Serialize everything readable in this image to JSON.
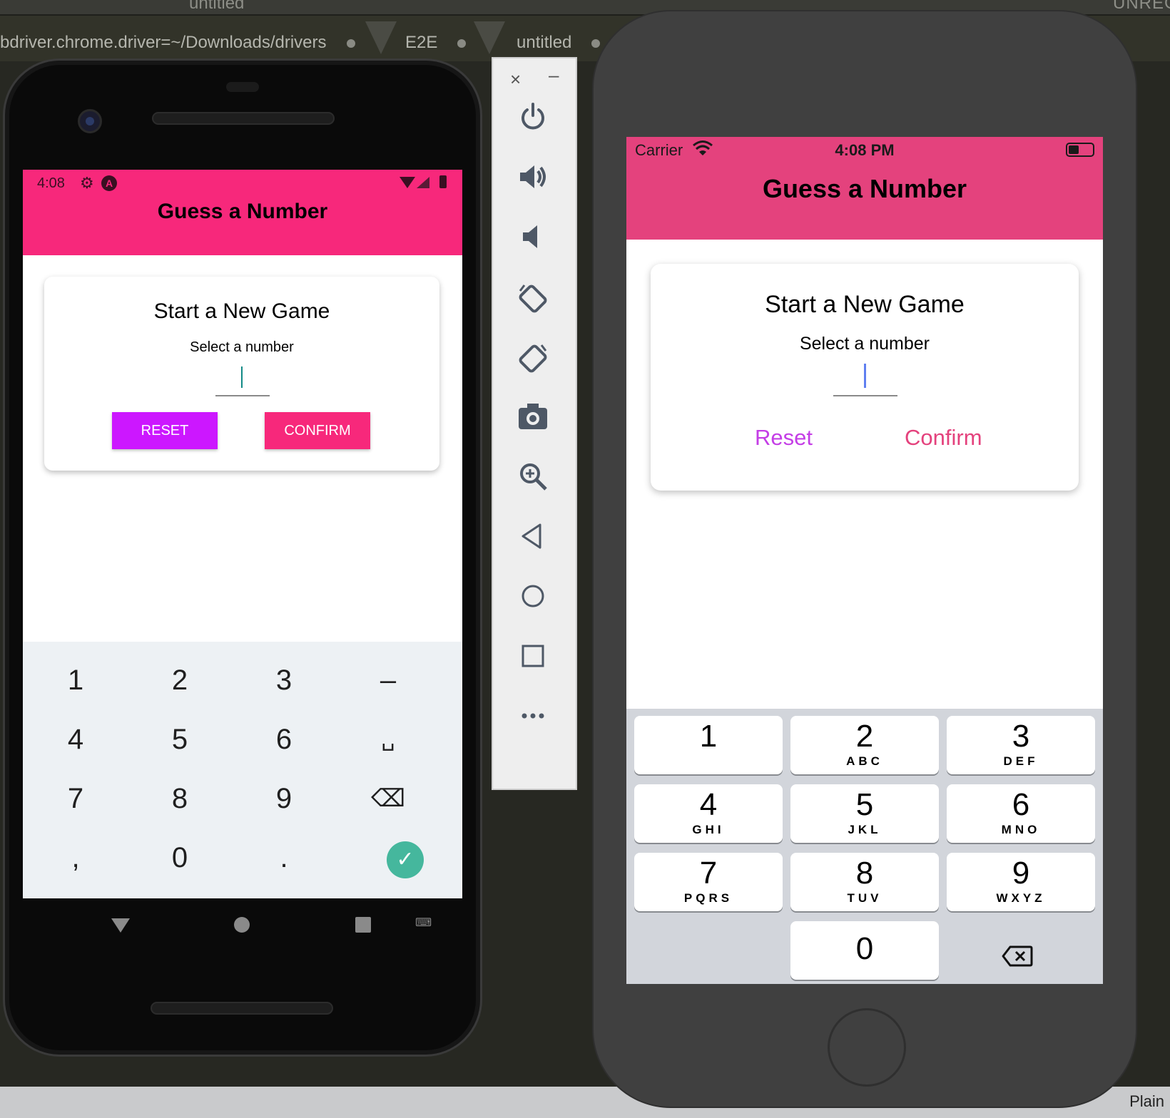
{
  "editor": {
    "window_title": "untitled",
    "unregistered": "UNREG",
    "tabs": [
      {
        "label": "bdriver.chrome.driver=~/Downloads/drivers"
      },
      {
        "label": "E2E"
      },
      {
        "label": "untitled"
      }
    ],
    "status_right": "Plain"
  },
  "android": {
    "status_time": "4:08",
    "header_title": "Guess a Number",
    "card_title": "Start a New Game",
    "card_subtitle": "Select a number",
    "input_value": "",
    "reset_label": "RESET",
    "confirm_label": "CONFIRM",
    "colors": {
      "primary": "#f7287b",
      "accent": "#cc17ff"
    },
    "keypad": [
      [
        "1",
        "2",
        "3",
        "–"
      ],
      [
        "4",
        "5",
        "6",
        "␣"
      ],
      [
        "7",
        "8",
        "9",
        "⌫"
      ],
      [
        ",",
        "0",
        ".",
        "✓"
      ]
    ]
  },
  "emulator_toolbar": {
    "close": "×",
    "minimize": "–",
    "buttons": [
      "power-icon",
      "volume-up-icon",
      "volume-down-icon",
      "rotate-left-icon",
      "rotate-right-icon",
      "camera-icon",
      "zoom-icon",
      "back-icon",
      "home-icon",
      "overview-icon",
      "more-icon"
    ]
  },
  "ios": {
    "carrier": "Carrier",
    "status_time": "4:08 PM",
    "header_title": "Guess a Number",
    "card_title": "Start a New Game",
    "card_subtitle": "Select a number",
    "input_value": "",
    "reset_label": "Reset",
    "confirm_label": "Confirm",
    "colors": {
      "primary": "#e4427d",
      "accent": "#c43ee6"
    },
    "keypad": [
      {
        "num": "1",
        "letters": ""
      },
      {
        "num": "2",
        "letters": "ABC"
      },
      {
        "num": "3",
        "letters": "DEF"
      },
      {
        "num": "4",
        "letters": "GHI"
      },
      {
        "num": "5",
        "letters": "JKL"
      },
      {
        "num": "6",
        "letters": "MNO"
      },
      {
        "num": "7",
        "letters": "PQRS"
      },
      {
        "num": "8",
        "letters": "TUV"
      },
      {
        "num": "9",
        "letters": "WXYZ"
      },
      {
        "num": "0",
        "letters": ""
      }
    ]
  }
}
